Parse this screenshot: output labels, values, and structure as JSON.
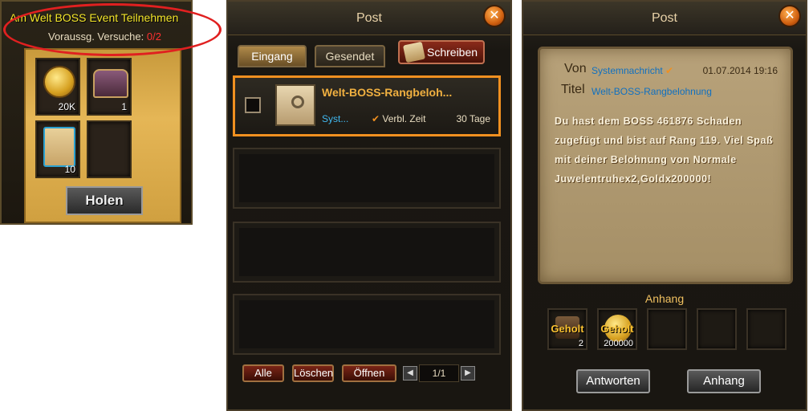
{
  "reward_panel": {
    "title": "Am Welt BOSS Event Teilnehmen",
    "attempts_label": "Voraussg. Versuche:",
    "attempts_value": "0/2",
    "slots": [
      {
        "icon": "gold-coin-icon",
        "qty": "20K"
      },
      {
        "icon": "treasure-chest-icon",
        "qty": "1"
      },
      {
        "icon": "scroll-icon",
        "qty": "10"
      },
      {
        "icon": "empty-slot",
        "qty": ""
      }
    ],
    "holen_label": "Holen"
  },
  "mail_list": {
    "title": "Post",
    "tabs": [
      "Eingang",
      "Gesendet"
    ],
    "write_label": "Schreiben",
    "items": [
      {
        "subject": "Welt-BOSS-Rangbeloh...",
        "sender": "Syst...",
        "remain_label": "Verbl. Zeit",
        "days": "30 Tage"
      }
    ],
    "buttons": {
      "all": "Alle",
      "delete": "Löschen",
      "open": "Öffnen"
    },
    "pager": "1/1"
  },
  "mail_detail": {
    "title": "Post",
    "from_label": "Von",
    "from_value": "Systemnachricht",
    "date": "01.07.2014 19:16",
    "title_label": "Titel",
    "title_value": "Welt-BOSS-Rangbelohnung",
    "body": "Du hast dem BOSS 461876 Schaden zugefügt und bist auf Rang 119. Viel Spaß mit deiner Belohnung von Normale Juwelentruhex2,Goldx200000!",
    "attachment_header": "Anhang",
    "attachments": [
      {
        "status": "Geholt",
        "qty": "2",
        "icon": "chest-icon"
      },
      {
        "status": "Geholt",
        "qty": "200000",
        "icon": "gold-coin-icon"
      }
    ],
    "reply_label": "Antworten",
    "attachment_button": "Anhang"
  },
  "colors": {
    "accent_orange": "#f09020",
    "link_blue": "#40b8f0",
    "annotation_red": "#e02020"
  }
}
